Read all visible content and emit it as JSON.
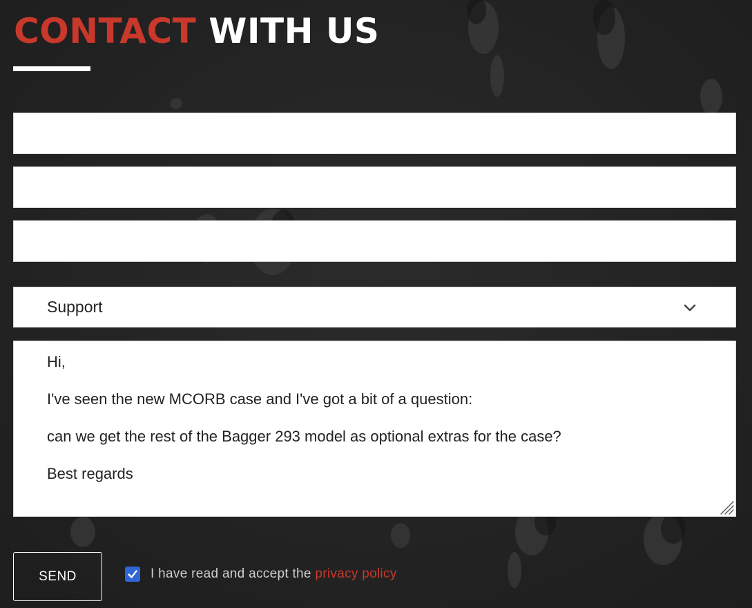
{
  "heading": {
    "accent": "CONTACT",
    "rest": "WITH US"
  },
  "form": {
    "name_value": "",
    "email_value": "",
    "phone_value": "",
    "subject_selected": "Support",
    "message_lines": [
      "Hi,",
      "I've seen the new MCORB case and I've got a bit of a question:",
      "can we get the rest of the Bagger 293 model as optional extras for the case?",
      "Best regards"
    ],
    "send_label": "SEND",
    "consent_checked": true,
    "consent_text": "I have read and accept the",
    "consent_link": "privacy policy"
  },
  "icons": {
    "select_arrow": "chevron-down-icon",
    "textarea_resize": "resize-grip-icon",
    "checkbox": "checkmark-icon"
  },
  "colors": {
    "accent": "#c8382b",
    "background": "#252525",
    "checkbox": "#2f66d6",
    "text_light": "#ffffff"
  }
}
